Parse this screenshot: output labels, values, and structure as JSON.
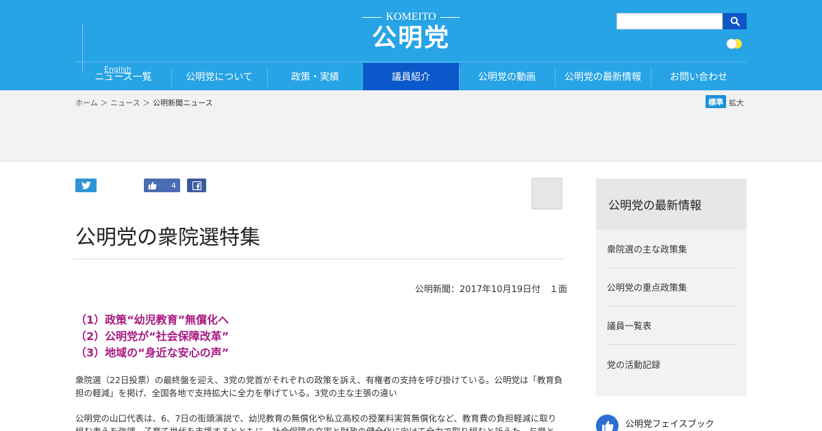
{
  "header": {
    "logo_en": "KOMEITO",
    "logo_jp": "公明党",
    "search_placeholder": "",
    "lang_link": "English",
    "nav": [
      {
        "label": "ニュース一覧",
        "active": false
      },
      {
        "label": "公明党について",
        "active": false
      },
      {
        "label": "政策・実績",
        "active": false
      },
      {
        "label": "議員紹介",
        "active": true
      },
      {
        "label": "公明党の動画",
        "active": false
      },
      {
        "label": "公明党の最新情報",
        "active": false
      },
      {
        "label": "お問い合わせ",
        "active": false
      }
    ]
  },
  "breadcrumb": {
    "items": [
      "ホーム ＞",
      "ニュース ＞"
    ],
    "current": "公明新聞ニュース"
  },
  "font_size": {
    "standard": "標準",
    "large": "拡大"
  },
  "share": {
    "like_count": "4"
  },
  "article": {
    "title": "公明党の衆院選特集",
    "pubdate": "公明新聞：2017年10月19日付　１面",
    "subheads": [
      "（1）政策“幼児教育”無償化へ",
      "（2）公明党が“社会保障改革”",
      "（3）地域の“身近な安心の声”"
    ],
    "paragraphs": [
      "衆院選（22日投票）の最終盤を迎え、3党の党首がそれぞれの政策を訴え、有権者の支持を呼び掛けている。公明党は「教育負担の軽減」を掲げ、全国各地で支持拡大に全力を挙げている。3党の主な主張の違い",
      "公明党の山口代表は、6、7日の街頭演説で、幼児教育の無償化や私立高校の授業料実質無償化など、教育費の負担軽減に取り組む考えを強調。子育て世代を支援するとともに、社会保障の充実と財政の健全化に向けて全力で取り組むと訴えた。与党として責任ある政治を進める決意を改めて示した。"
    ]
  },
  "sidebar": {
    "heading": "公明党の最新情報",
    "items": [
      "衆院選の主な政策集",
      "公明党の重点政策集",
      "議員一覧表",
      "党の活動記録"
    ],
    "fan_label": "公明党フェイスブック"
  },
  "colors": {
    "header_blue": "#27a4e6",
    "nav_active": "#0a58c9",
    "subhead_magenta": "#a81882"
  }
}
